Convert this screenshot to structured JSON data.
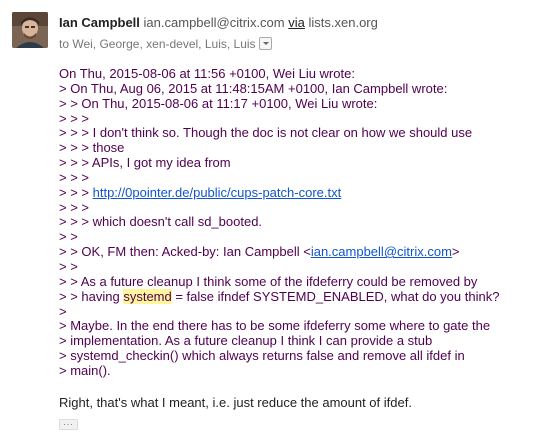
{
  "header": {
    "sender_name": "Ian Campbell",
    "sender_email": "ian.campbell@citrix.com",
    "via_label": "via",
    "via_domain": "lists.xen.org",
    "recipients": "to Wei, George, xen-devel, Luis, Luis"
  },
  "quoted": {
    "lines": [
      "On Thu, 2015-08-06 at 11:56 +0100, Wei Liu wrote:",
      "> On Thu, Aug 06, 2015 at 11:48:15AM +0100, Ian Campbell wrote:",
      "> > On Thu, 2015-08-06 at 11:17 +0100, Wei Liu wrote:",
      "> > >",
      "> > > I don't think so. Though the doc is not clear on how we should use",
      "> > > those",
      "> > > APIs, I got my idea from",
      "> > >",
      "> > > ",
      "> > >",
      "> > > which doesn't call sd_booted.",
      "> >",
      "> > OK, FM then: Acked-by: Ian Campbell <",
      "> >",
      "> > As a future cleanup I think some of the ifdeferry could be removed by",
      "> > having ",
      ">",
      "> Maybe. In the end there has to be some ifdeferry some where to gate the",
      "> implementation. As a future cleanup I think I can provide a stub",
      "> systemd_checkin() which always returns false and remove all ifdef in",
      "> main()."
    ],
    "link_url": "http://0pointer.de/public/cups-patch-core.txt",
    "ack_email": "ian.campbell@citrix.com",
    "ack_close": ">",
    "highlight_word": "systemd",
    "line16_rest": " = false ifndef SYSTEMD_ENABLED, what do you think?"
  },
  "reply_text": "Right, that's what I meant, i.e. just reduce the amount of ifdef.",
  "trimmed_label": "...",
  "colors": {
    "quoted_text": "#500050",
    "link": "#1155cc",
    "highlight": "#fff59d"
  },
  "icons": {
    "avatar": "sender-avatar",
    "details_toggle": "chevron-down-icon"
  }
}
